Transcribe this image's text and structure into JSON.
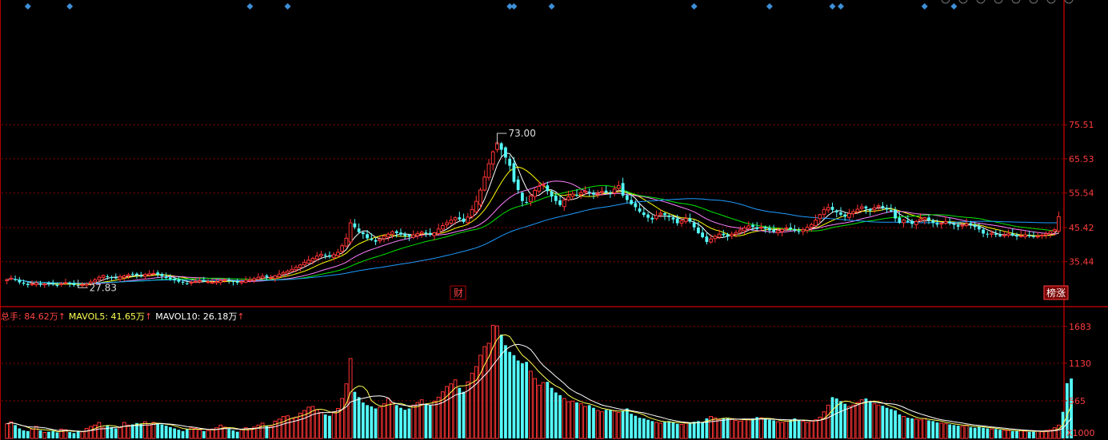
{
  "colors": {
    "up": "#FF3333",
    "down": "#54FCFC",
    "frame": "#B00000",
    "grid": "#8A0000",
    "axisText": "#FF3B3B",
    "ma5": "#FFFFFF",
    "ma10": "#FFFF00",
    "ma20": "#FF80FF",
    "ma30": "#00E600",
    "ma60": "#1E9BFF",
    "marker": "#3D8FD8",
    "volHeadRed": "#FF3333",
    "volHeadYellow": "#FFFF55",
    "volHeadWhite": "#FFFFFF"
  },
  "volume_header": {
    "total_label": "总手: 84.62万",
    "mavol5_label": "MAVOL5: 41.65万",
    "mavol10_label": "MAVOL10: 26.18万",
    "arrow": "↑"
  },
  "badges": {
    "finance": "财",
    "ranking": "榜涨"
  },
  "annotations": {
    "high": "73.00",
    "low": "27.83"
  },
  "icons": [
    "expand-icon",
    "settings-icon",
    "list-icon",
    "minus-icon",
    "flag-icon",
    "square-icon",
    "up-icon",
    "menu-icon"
  ],
  "chart_data": [
    {
      "type": "candlestick",
      "price_axis": {
        "ticks": [
          "75.51",
          "65.53",
          "55.54",
          "45.42",
          "35.44"
        ],
        "tick_values": [
          75.51,
          65.53,
          55.54,
          45.42,
          35.44
        ],
        "ylim": [
          25.0,
          75.51
        ]
      },
      "moving_averages": [
        "MA5",
        "MA10",
        "MA20",
        "MA30",
        "MA60"
      ],
      "high_value": 73.0,
      "low_value": 27.83,
      "closes": [
        30.2,
        30.6,
        30.1,
        29.4,
        29.0,
        28.6,
        28.9,
        29.2,
        28.7,
        28.9,
        29.0,
        28.8,
        28.6,
        29.0,
        29.3,
        28.9,
        28.6,
        28.4,
        28.7,
        28.9,
        29.5,
        30.1,
        30.9,
        31.4,
        31.0,
        30.8,
        30.6,
        31.0,
        31.3,
        31.6,
        31.8,
        31.5,
        31.2,
        31.7,
        31.9,
        32.0,
        31.6,
        31.2,
        30.7,
        30.4,
        30.0,
        29.6,
        29.3,
        29.1,
        29.4,
        29.7,
        29.9,
        29.8,
        29.6,
        29.4,
        29.6,
        29.9,
        30.1,
        29.8,
        29.5,
        29.3,
        29.6,
        30.0,
        30.2,
        30.5,
        30.9,
        31.2,
        31.0,
        30.8,
        31.3,
        31.8,
        32.3,
        32.7,
        33.2,
        33.8,
        34.5,
        35.2,
        35.9,
        36.4,
        37.1,
        37.6,
        37.2,
        36.9,
        37.5,
        38.2,
        40.1,
        42.3,
        46.8,
        45.5,
        44.1,
        43.5,
        42.3,
        41.8,
        41.3,
        42.0,
        42.9,
        43.5,
        44.2,
        43.8,
        43.4,
        43.0,
        42.8,
        43.3,
        43.7,
        44.1,
        43.6,
        43.3,
        43.9,
        45.0,
        46.0,
        46.8,
        47.6,
        48.3,
        47.8,
        47.1,
        48.5,
        50.7,
        53.1,
        56.4,
        60.2,
        64.1,
        67.6,
        70.2,
        68.2,
        65.9,
        63.5,
        58.8,
        56.4,
        53.2,
        52.8,
        54.7,
        56.3,
        57.5,
        58.0,
        56.1,
        54.5,
        53.2,
        52.0,
        53.5,
        54.4,
        55.2,
        54.9,
        55.6,
        56.1,
        55.7,
        55.1,
        55.5,
        56.0,
        55.8,
        55.4,
        56.7,
        57.7,
        54.8,
        53.5,
        52.3,
        51.4,
        50.1,
        49.1,
        48.3,
        47.8,
        48.9,
        49.6,
        49.1,
        48.5,
        47.8,
        46.7,
        47.4,
        48.1,
        47.2,
        45.5,
        43.8,
        42.6,
        41.2,
        42.1,
        42.9,
        43.5,
        43.2,
        42.8,
        43.5,
        44.0,
        44.7,
        45.3,
        45.9,
        45.6,
        45.0,
        45.5,
        45.1,
        44.6,
        44.2,
        44.5,
        44.9,
        45.3,
        45.0,
        44.6,
        44.2,
        44.8,
        45.5,
        46.3,
        47.6,
        49.2,
        50.7,
        51.3,
        50.6,
        49.9,
        49.2,
        48.6,
        49.5,
        50.1,
        50.8,
        51.5,
        51.0,
        50.4,
        51.2,
        51.8,
        51.3,
        50.7,
        50.2,
        48.1,
        46.8,
        47.6,
        47.1,
        46.5,
        47.2,
        47.9,
        48.3,
        47.5,
        46.8,
        46.3,
        46.7,
        47.2,
        46.8,
        46.2,
        45.7,
        46.1,
        46.5,
        46.2,
        45.6,
        44.9,
        43.7,
        43.4,
        43.8,
        43.3,
        42.9,
        43.2,
        43.6,
        43.1,
        42.8,
        43.0,
        43.3,
        43.0,
        42.7,
        42.9,
        43.2,
        43.6,
        44.2,
        44.8,
        48.6
      ],
      "volume_axis": {
        "ticks": [
          "1683",
          "1130",
          "565"
        ],
        "tick_values": [
          1683,
          1130,
          565
        ],
        "unit": "X1000",
        "ylim": [
          0,
          1740
        ]
      },
      "volumes": [
        220,
        250,
        200,
        150,
        120,
        110,
        140,
        180,
        120,
        90,
        100,
        110,
        90,
        140,
        130,
        95,
        80,
        110,
        100,
        150,
        180,
        200,
        240,
        160,
        190,
        170,
        150,
        160,
        240,
        200,
        210,
        230,
        220,
        250,
        200,
        240,
        230,
        210,
        190,
        170,
        150,
        130,
        110,
        140,
        160,
        150,
        130,
        110,
        120,
        140,
        160,
        200,
        170,
        140,
        120,
        100,
        130,
        160,
        150,
        170,
        200,
        230,
        190,
        180,
        260,
        290,
        330,
        340,
        300,
        320,
        380,
        420,
        470,
        480,
        430,
        390,
        360,
        340,
        400,
        450,
        600,
        820,
        1200,
        700,
        620,
        540,
        500,
        480,
        450,
        470,
        520,
        600,
        540,
        500,
        460,
        430,
        450,
        500,
        540,
        580,
        520,
        500,
        560,
        620,
        700,
        780,
        820,
        880,
        760,
        700,
        850,
        980,
        1080,
        1250,
        1380,
        1430,
        1700,
        1690,
        1560,
        1400,
        1300,
        1250,
        1170,
        1130,
        1150,
        1010,
        900,
        800,
        840,
        850,
        760,
        690,
        650,
        600,
        550,
        560,
        540,
        520,
        480,
        500,
        460,
        420,
        400,
        430,
        430,
        410,
        390,
        410,
        450,
        370,
        340,
        310,
        300,
        280,
        260,
        240,
        230,
        250,
        260,
        240,
        220,
        210,
        230,
        240,
        250,
        260,
        240,
        300,
        330,
        310,
        280,
        300,
        310,
        290,
        270,
        260,
        280,
        290,
        300,
        320,
        310,
        290,
        280,
        270,
        250,
        240,
        260,
        280,
        300,
        280,
        260,
        240,
        260,
        280,
        320,
        400,
        500,
        620,
        600,
        560,
        520,
        480,
        500,
        540,
        580,
        600,
        560,
        520,
        500,
        490,
        460,
        440,
        420,
        360,
        330,
        310,
        300,
        290,
        280,
        300,
        270,
        260,
        240,
        230,
        220,
        210,
        200,
        190,
        180,
        200,
        170,
        160,
        180,
        160,
        150,
        140,
        140,
        130,
        120,
        120,
        110,
        110,
        120,
        110,
        100,
        100,
        110,
        100,
        120,
        130,
        160,
        200,
        400,
        830,
        900
      ]
    }
  ]
}
